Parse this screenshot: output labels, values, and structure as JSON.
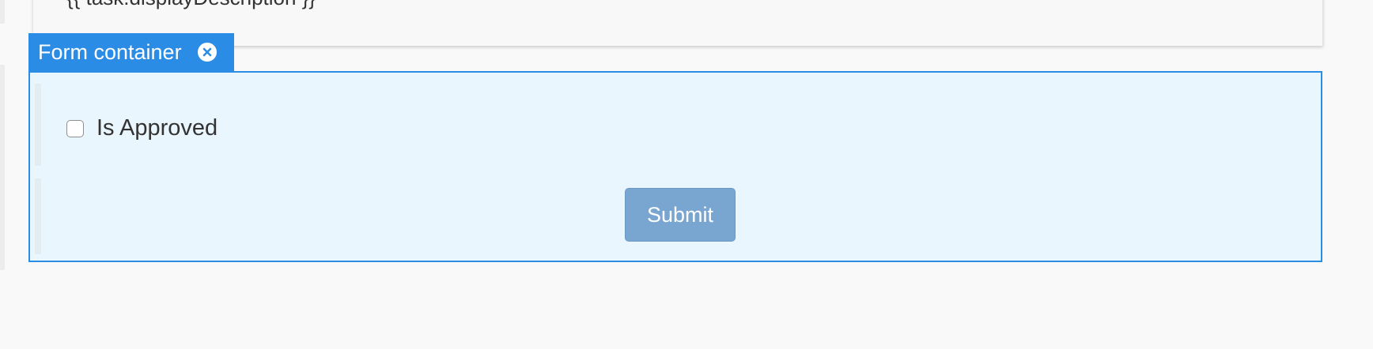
{
  "top_card": {
    "text": "{{ task.displayDescription }}"
  },
  "form_tab": {
    "label": "Form container",
    "close_icon": "close-circle-icon"
  },
  "form": {
    "checkbox": {
      "label": "Is Approved",
      "checked": false
    },
    "submit_label": "Submit"
  },
  "colors": {
    "accent": "#2b8ce6",
    "container_bg": "#eaf6fd",
    "submit_bg": "#79a6d0",
    "page_bg": "#f9f9f9"
  }
}
